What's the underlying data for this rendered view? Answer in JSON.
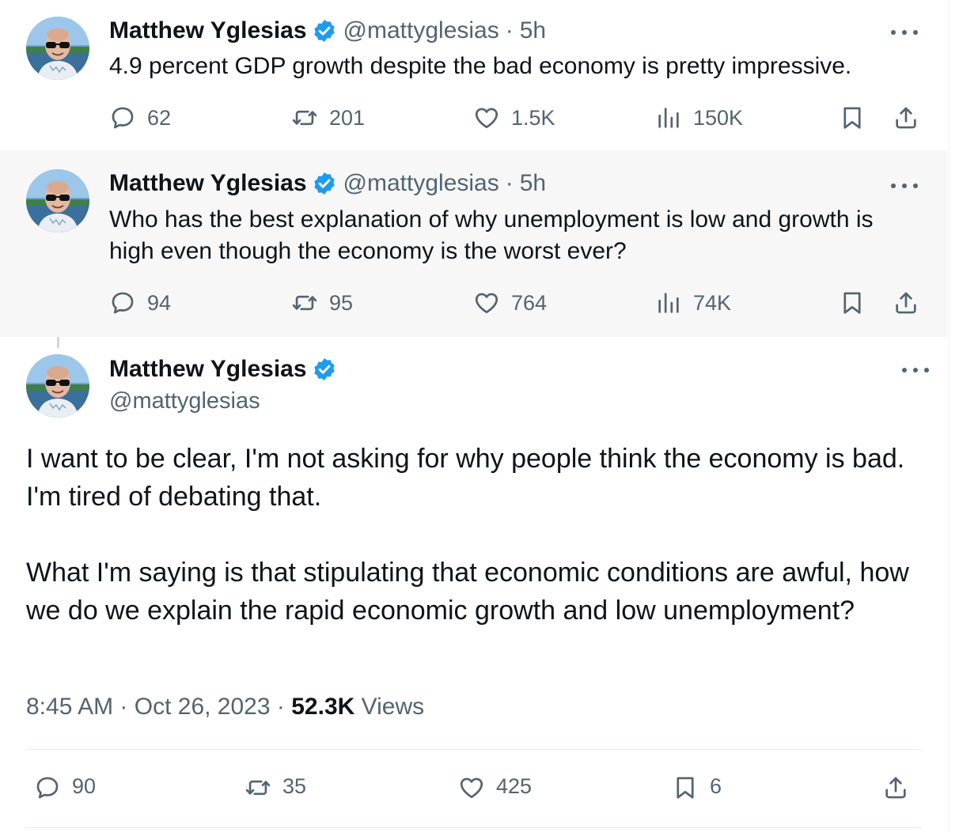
{
  "thread": [
    {
      "author": {
        "name": "Matthew Yglesias",
        "handle": "@mattyglesias"
      },
      "separator": "·",
      "age": "5h",
      "text": "4.9 percent GDP growth despite the bad economy is pretty impressive.",
      "stats": {
        "replies": "62",
        "reposts": "201",
        "likes": "1.5K",
        "views": "150K"
      }
    },
    {
      "author": {
        "name": "Matthew Yglesias",
        "handle": "@mattyglesias"
      },
      "separator": "·",
      "age": "5h",
      "text": "Who has the best explanation of why unemployment is low and growth is high even though the economy is the worst ever?",
      "stats": {
        "replies": "94",
        "reposts": "95",
        "likes": "764",
        "views": "74K"
      }
    }
  ],
  "main_tweet": {
    "author": {
      "name": "Matthew Yglesias",
      "handle": "@mattyglesias"
    },
    "paragraphs": [
      "I want to be clear, I'm not asking for why people think the economy is bad. I'm tired of debating that.",
      "What I'm saying is that stipulating that economic conditions are awful, how we do we explain the rapid economic growth and low unemployment?"
    ],
    "time": "8:45 AM",
    "separator": "·",
    "date": "Oct 26, 2023",
    "views_count": "52.3K",
    "views_label": "Views",
    "stats": {
      "replies": "90",
      "reposts": "35",
      "likes": "425",
      "bookmarks": "6"
    }
  },
  "colors": {
    "verified_badge": "#1d9bf0",
    "icon_gray": "#536471",
    "text": "#0f1419",
    "thread_line": "#cfd9de",
    "highlight_bg": "#f7f7f7"
  },
  "icons": {
    "reply": "speech-bubble-icon",
    "repost": "repost-arrows-icon",
    "like": "heart-icon",
    "views": "bar-chart-icon",
    "bookmark": "bookmark-icon",
    "share": "share-upload-icon",
    "more": "ellipsis-icon",
    "verified": "verified-badge-icon"
  }
}
